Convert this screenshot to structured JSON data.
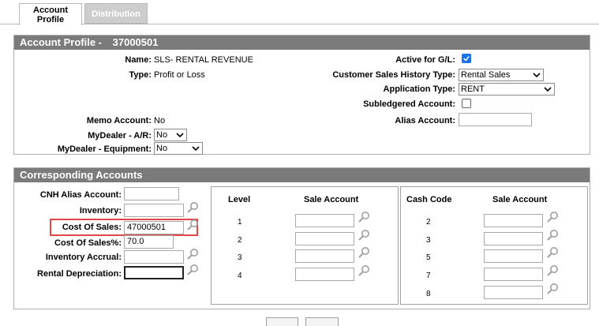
{
  "tabs": [
    {
      "label_line1": "Account",
      "label_line2": "Profile"
    },
    {
      "label": "Distribution"
    }
  ],
  "profile": {
    "title": "Account Profile -",
    "account_number": "37000501",
    "name_label": "Name:",
    "name_value": "SLS- RENTAL REVENUE",
    "type_label": "Type:",
    "type_value": "Profit or Loss",
    "memo_label": "Memo Account:",
    "memo_value": "No",
    "mydealer_ar_label": "MyDealer - A/R:",
    "mydealer_ar_value": "No",
    "mydealer_eq_label": "MyDealer - Equipment:",
    "mydealer_eq_value": "No",
    "active_gl_label": "Active for G/L:",
    "active_gl_checked": true,
    "cust_sales_label": "Customer Sales History Type:",
    "cust_sales_value": "Rental Sales",
    "app_type_label": "Application Type:",
    "app_type_value": "RENT",
    "subledgered_label": "Subledgered Account:",
    "subledgered_checked": false,
    "alias_label": "Alias Account:",
    "alias_value": ""
  },
  "corresponding": {
    "title": "Corresponding Accounts",
    "cnh_label": "CNH Alias Account:",
    "cnh_value": "",
    "inventory_label": "Inventory:",
    "inventory_value": "",
    "cost_sales_label": "Cost Of Sales:",
    "cost_sales_value": "47000501",
    "cost_sales_pct_label": "Cost Of Sales%:",
    "cost_sales_pct_value": "70.0",
    "inv_accrual_label": "Inventory Accrual:",
    "inv_accrual_value": "",
    "rental_dep_label": "Rental Depreciation:",
    "rental_dep_value": "",
    "level_header": "Level",
    "level_sale_header": "Sale Account",
    "levels": [
      "1",
      "2",
      "3",
      "4"
    ],
    "cash_header": "Cash Code",
    "cash_sale_header": "Sale Account",
    "cash_codes": [
      "2",
      "3",
      "5",
      "7",
      "8"
    ]
  },
  "colors": {
    "header_bg": "#7b7b7b",
    "highlight": "#e04848",
    "checkbox": "#1a73e8"
  }
}
